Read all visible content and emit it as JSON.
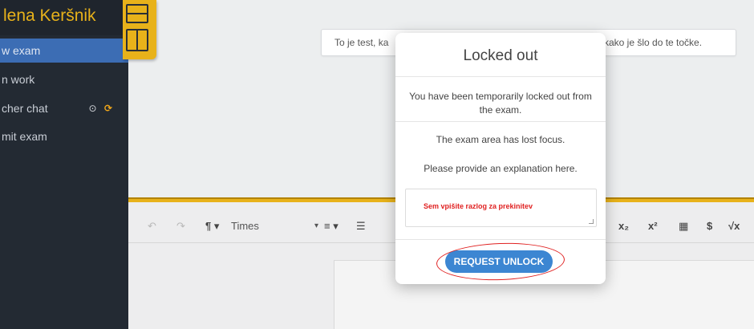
{
  "sidebar": {
    "student_name": "lena Keršnik",
    "items": [
      {
        "label": "w exam",
        "active": true
      },
      {
        "label": "n work",
        "active": false
      },
      {
        "label": "cher chat",
        "active": false
      },
      {
        "label": "mit exam",
        "active": false
      }
    ],
    "chat_icons": {
      "target": "⊙",
      "sync": "⟳"
    }
  },
  "question": {
    "text_left": "To je test, ka",
    "text_right": "kako je šlo do te točke."
  },
  "toolbar": {
    "undo": "↶",
    "redo": "↷",
    "paragraph": "¶ ▾",
    "font_family": "Times",
    "font_arrow": "▾",
    "align": "≡ ▾",
    "indent": "☰",
    "subscript": "x₂",
    "superscript": "x²",
    "table": "▦",
    "dollar": "$",
    "sqrt": "√x"
  },
  "modal": {
    "title": "Locked out",
    "message_1": "You have been temporarily locked out from the exam.",
    "message_2": "The exam area has lost focus.",
    "message_3": "Please provide an explanation here.",
    "placeholder": "Sem vpišite razlog za prekinitev",
    "button_label": "REQUEST UNLOCK"
  },
  "colors": {
    "accent_gold": "#e8b21a",
    "sidebar_bg": "#232a33",
    "active_item": "#3c6db4",
    "button_blue": "#3c86d2",
    "annotation_red": "#e02222"
  }
}
